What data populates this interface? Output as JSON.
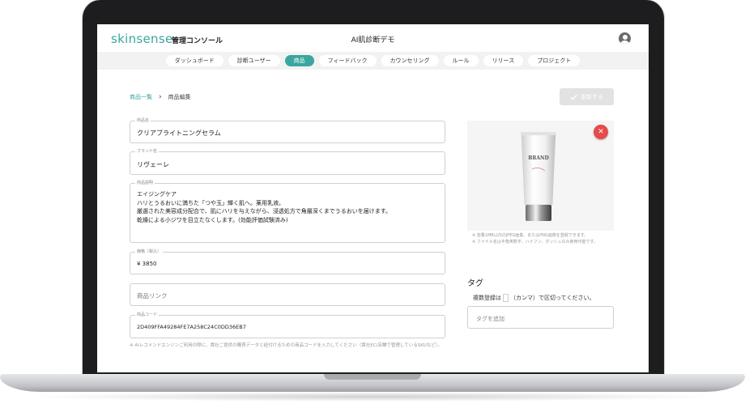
{
  "header": {
    "brand": "skinsense",
    "console_label": "管理コンソール",
    "center_title": "AI肌診断デモ",
    "user_icon": "account-circle-icon"
  },
  "tabs": [
    {
      "label": "ダッシュボード",
      "active": false
    },
    {
      "label": "診断ユーザー",
      "active": false
    },
    {
      "label": "商品",
      "active": true
    },
    {
      "label": "フィードバック",
      "active": false
    },
    {
      "label": "カウンセリング",
      "active": false
    },
    {
      "label": "ルール",
      "active": false
    },
    {
      "label": "リリース",
      "active": false
    },
    {
      "label": "プロジェクト",
      "active": false
    }
  ],
  "breadcrumb": {
    "parent": "商品一覧",
    "separator": "›",
    "current": "商品編集"
  },
  "update_button": {
    "label": "更新する",
    "icon": "check-icon"
  },
  "form": {
    "product_name": {
      "label": "商品名",
      "value": "クリアブライトニングセラム"
    },
    "brand_name": {
      "label": "ブランド名",
      "value": "リヴェーレ"
    },
    "description": {
      "label": "商品説明",
      "value": "エイジングケア\nハリとうるおいに満ちた「つや玉」輝く肌へ。薬用乳液。\n厳選された美容成分配合で、肌にハリを与えながら、浸透処方で角層深くまでうるおいを届けます。\n乾燥による小ジワを目立たなくします。(効能評価試験済み)"
    },
    "price": {
      "label": "価格（税込）",
      "value": "¥  3850"
    },
    "product_link": {
      "placeholder": "商品リンク"
    },
    "product_code": {
      "label": "商品コード",
      "value": "2D409FFA49284FE7A258C24C0DD36EB7"
    },
    "code_note": "※ AIレコメンドエンジンご利用の際に、貴社ご提供の購買データと紐付けるための商品コードを入力してください（貴社EC/店舗で管理しているSKUなど）。"
  },
  "image_panel": {
    "remove_icon": "close-icon",
    "product_brand_text": "BRAND",
    "notes": [
      "※ 容量1MB以内のJPEG画像、またはPNG画像を登録できます。",
      "※ ファイル名は半角英数字、ハイフン、ダッシュのみ使用可能です。"
    ]
  },
  "tags": {
    "title": "タグ",
    "help_prefix": "複数登録は",
    "help_suffix": "（カンマ）で区切ってください。",
    "placeholder": "タグを追加"
  },
  "colors": {
    "accent": "#3aa6a0",
    "remove": "#e54b4b"
  }
}
